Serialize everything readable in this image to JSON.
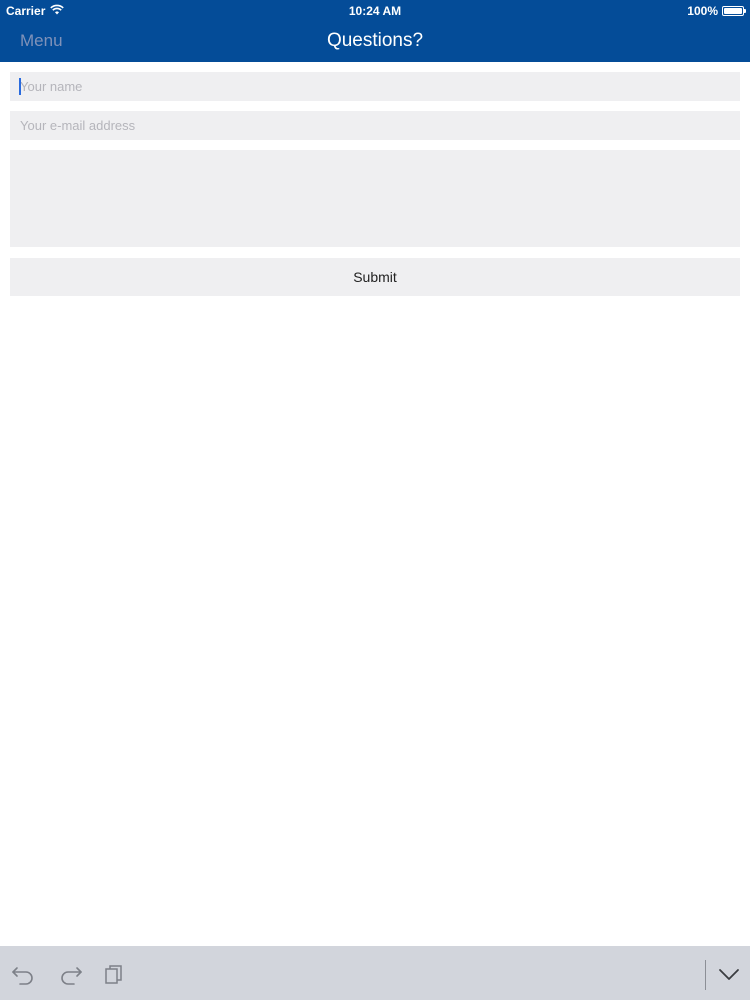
{
  "status_bar": {
    "carrier": "Carrier",
    "time": "10:24 AM",
    "battery": "100%",
    "icons": [
      "wifi-icon",
      "battery-icon"
    ]
  },
  "nav": {
    "menu_label": "Menu",
    "title": "Questions?"
  },
  "form": {
    "name_placeholder": "Your name",
    "email_placeholder": "Your e-mail address",
    "message_value": "",
    "submit_label": "Submit"
  },
  "keyboard_toolbar": {
    "icons": [
      "undo-icon",
      "redo-icon",
      "paste-icon",
      "chevron-down-icon"
    ]
  },
  "colors": {
    "nav_background": "#044c98",
    "menu_text": "#7f92b9",
    "field_background": "#efeff1",
    "toolbar_background": "#d2d5dc",
    "caret": "#2a6bde"
  }
}
